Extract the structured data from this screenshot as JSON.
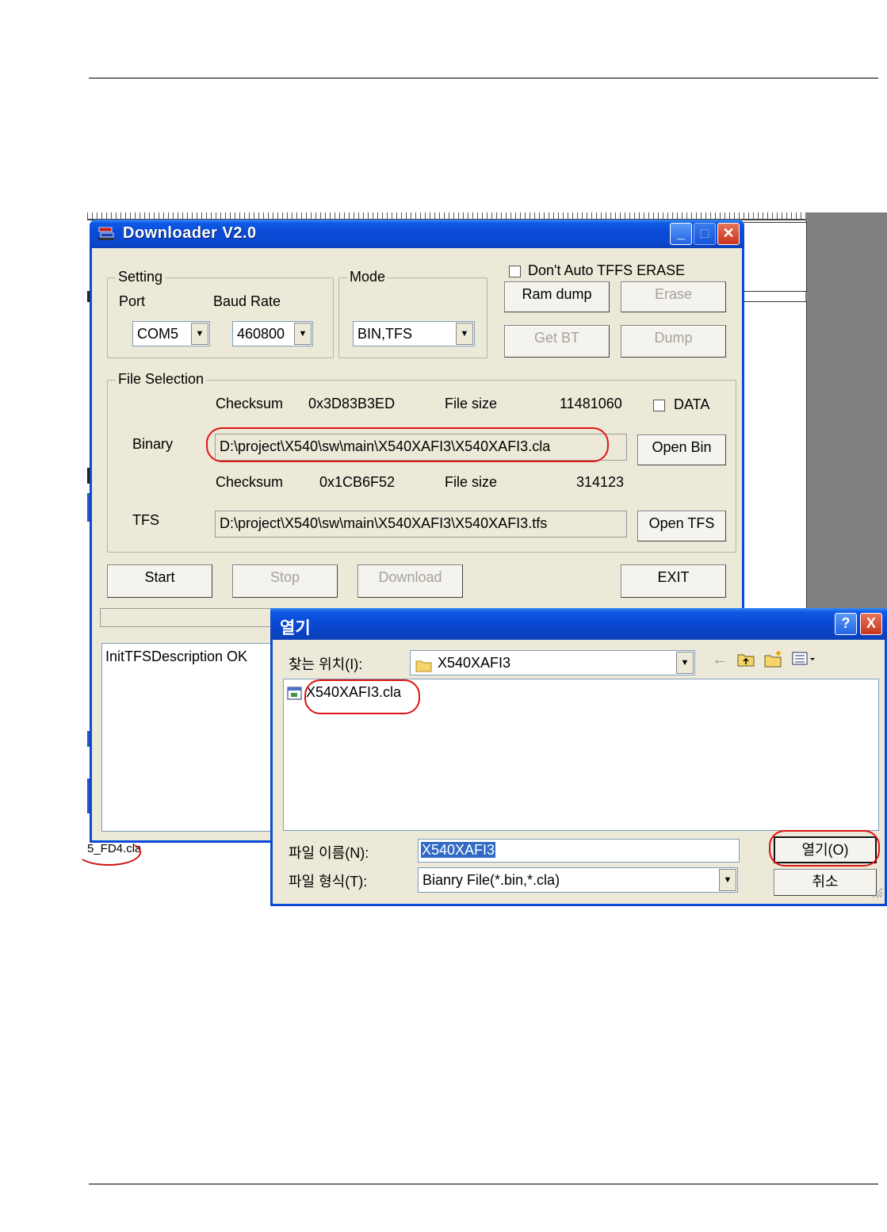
{
  "downloader": {
    "title": "Downloader V2.0",
    "setting_group": "Setting",
    "port_label": "Port",
    "baud_label": "Baud Rate",
    "port_value": "COM5",
    "baud_value": "460800",
    "mode_group": "Mode",
    "mode_value": "BIN,TFS",
    "dont_auto_tffs_erase": "Don't Auto TFFS ERASE",
    "ram_dump": "Ram dump",
    "erase": "Erase",
    "get_bt": "Get BT",
    "dump": "Dump",
    "file_selection_group": "File Selection",
    "checksum_label": "Checksum",
    "file_size_label": "File size",
    "binary": {
      "label": "Binary",
      "checksum": "0x3D83B3ED",
      "file_size": "11481060",
      "path": "D:\\project\\X540\\sw\\main\\X540XAFI3\\X540XAFI3.cla",
      "open_button": "Open Bin"
    },
    "data_checkbox": "DATA",
    "tfs": {
      "label": "TFS",
      "checksum": "0x1CB6F52",
      "file_size": "314123",
      "path": "D:\\project\\X540\\sw\\main\\X540XAFI3\\X540XAFI3.tfs",
      "open_button": "Open TFS"
    },
    "start": "Start",
    "stop": "Stop",
    "download": "Download",
    "exit": "EXIT",
    "log_text": "InitTFSDescription OK",
    "progress_fraction": 0
  },
  "background": {
    "cla_fragment": "5_FD4.cla"
  },
  "open_dialog": {
    "title": "열기",
    "help_button": "?",
    "close_button": "X",
    "look_in_label": "찾는 위치(I):",
    "look_in_value": "X540XAFI3",
    "files": [
      "X540XAFI3.cla"
    ],
    "file_name_label": "파일 이름(N):",
    "file_name_value": "X540XAFI3",
    "file_type_label": "파일 형식(T):",
    "file_type_value": "Bianry File(*.bin,*.cla)",
    "open_button": "열기(O)",
    "cancel_button": "취소"
  },
  "icons": {
    "app": "downloader-app-icon",
    "back": "back-arrow-icon",
    "up": "up-folder-icon",
    "new_folder": "new-folder-icon",
    "views": "view-menu-icon",
    "folder": "folder-icon",
    "file": "cla-file-icon"
  },
  "colors": {
    "xp_blue": "#0a4ad6",
    "window_face": "#ece9d8",
    "highlight_ring": "#e01414",
    "selection": "#316ac5"
  }
}
